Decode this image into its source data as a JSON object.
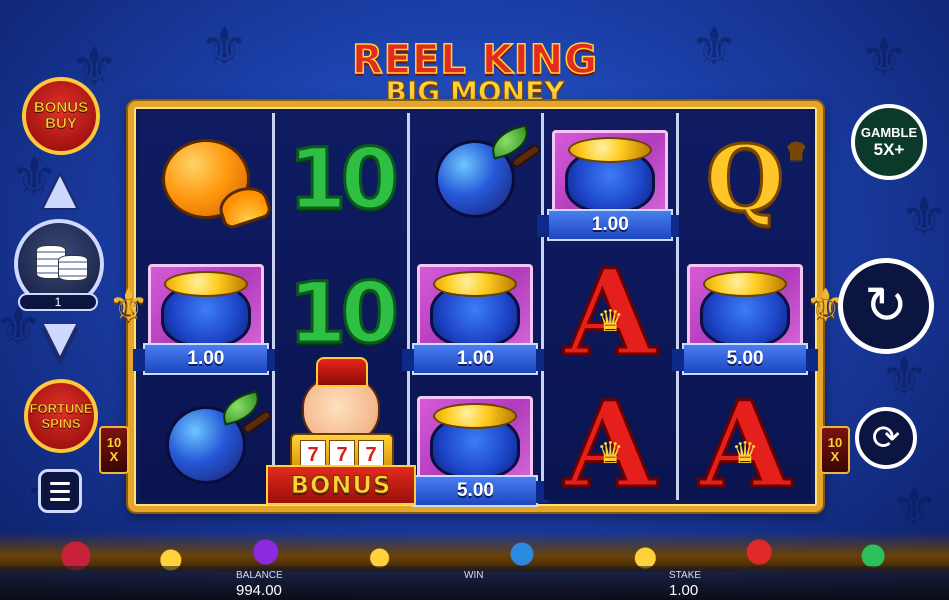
{
  "game": {
    "title_line1": "REEL KING",
    "title_line2": "BIG MONEY"
  },
  "colors": {
    "background": "#1b3fa8",
    "frame_gold": "#e4a62a",
    "reel_bg": "#0f1c63"
  },
  "controls": {
    "bonus_buy_label": "BONUS BUY",
    "bet_level": "1",
    "fortune_spins_label": "FORTUNE SPINS",
    "gamble_label": "GAMBLE",
    "gamble_multiplier": "5X+",
    "side_multiplier": "10",
    "side_multiplier_suffix": "X",
    "spin_icon": "spin-arrow-icon",
    "autoplay_icon": "autoplay-icon",
    "menu_icon": "hamburger-menu-icon"
  },
  "reels": [
    [
      "orange",
      "pot:1.00",
      "plum"
    ],
    [
      "ten",
      "ten",
      "king-bonus"
    ],
    [
      "plum",
      "pot:1.00",
      "pot:5.00"
    ],
    [
      "pot:1.00",
      "ace",
      "ace"
    ],
    [
      "queen",
      "pot:5.00",
      "ace"
    ]
  ],
  "symbols": {
    "ten_label": "10",
    "queen_label": "Q",
    "ace_label": "A",
    "pot_values": {
      "r2c1": "1.00",
      "r3c2": "1.00",
      "r3c3": "5.00",
      "r4c1": "1.00",
      "r5c2": "5.00"
    },
    "slot_digits": [
      "7",
      "7",
      "7"
    ],
    "bonus_label": "BONUS"
  },
  "status": {
    "balance_label": "BALANCE",
    "balance_value": "994.00",
    "win_label": "WIN",
    "win_value": "",
    "stake_label": "STAKE",
    "stake_value": "1.00"
  }
}
